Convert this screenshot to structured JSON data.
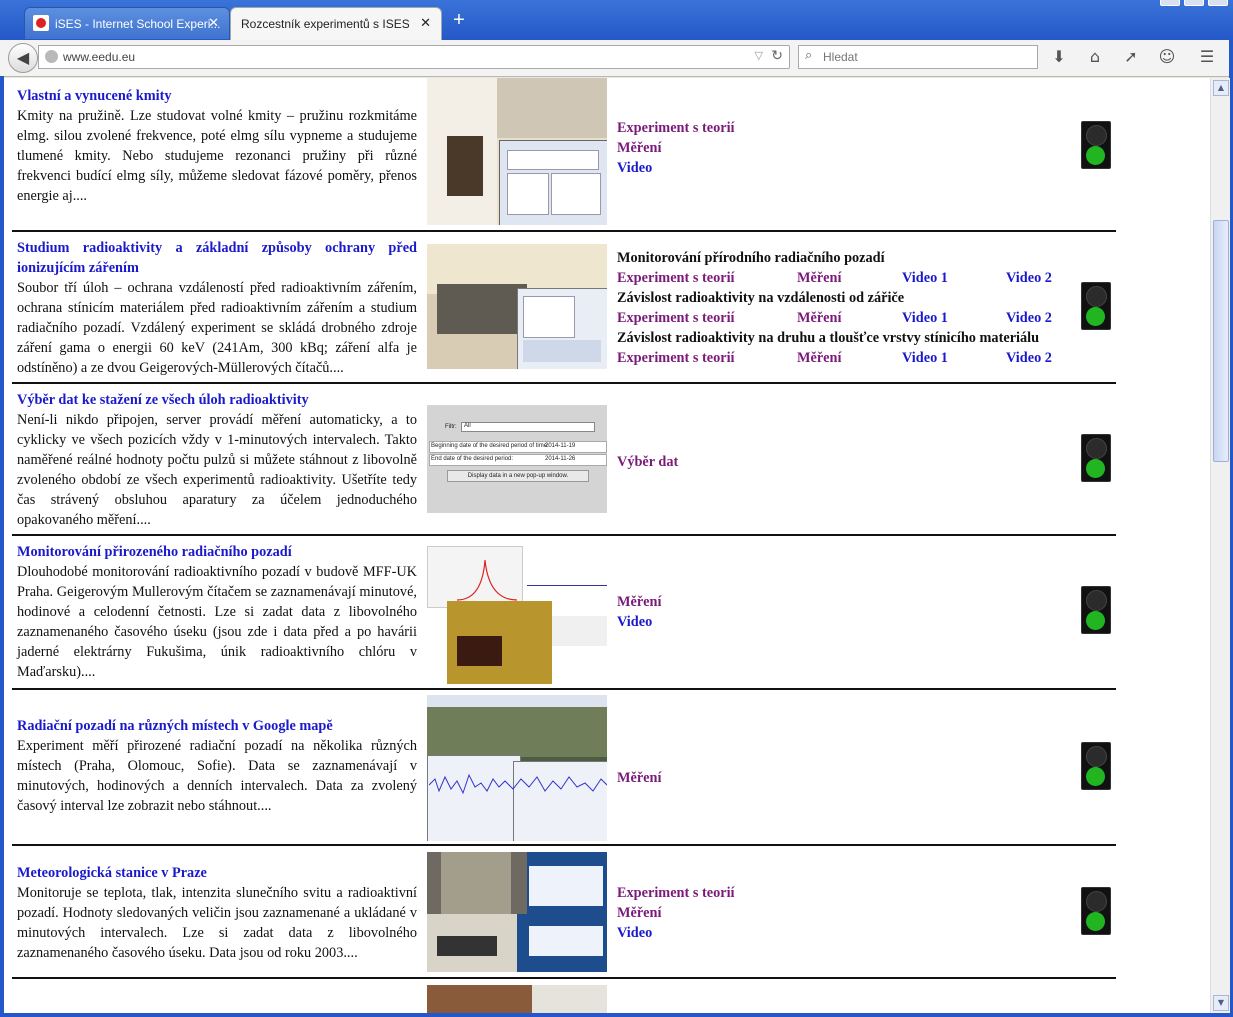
{
  "browser": {
    "tabs": [
      {
        "label": "iSES - Internet School Experi...",
        "close": "✕",
        "active": false
      },
      {
        "label": "Rozcestník experimentů s ISES a i...",
        "close": "✕",
        "active": true
      }
    ],
    "new_tab": "+",
    "url": "www.eedu.eu",
    "search_placeholder": "Hledat"
  },
  "rows": [
    {
      "title": "Vlastní a vynucené kmity",
      "text": "Kmity na pružině. Lze studovat volné kmity – pružinu rozkmitáme elmg. silou zvolené frekvence, poté elmg sílu vypneme a studujeme tlumené kmity. Nebo studujeme rezonanci pružiny při různé frekvenci budící elmg síly, můžeme sledovat fázové poměry, přenos energie aj....",
      "links": [
        "Experiment s teorií",
        "Měření",
        "Video"
      ]
    },
    {
      "title": "Studium radioaktivity a základní způsoby ochrany před ionizujícím zářením",
      "text": "Soubor tří úloh – ochrana vzdáleností před radioaktivním zářením, ochrana stínicím materiálem před radioaktivním zářením a studium radiačního pozadí. Vzdálený experiment se skládá drobného zdroje záření gama o energii 60 keV (241Am, 300 kBq; záření alfa je odstíněno) a ze dvou Geigerových-Müllerových čítačů....",
      "groups": [
        {
          "title": "Monitorování přírodního radiačního pozadí",
          "links": [
            "Experiment s teorií",
            "Měření",
            "Video 1",
            "Video 2"
          ]
        },
        {
          "title": "Závislost radioaktivity na vzdálenosti od zářiče",
          "links": [
            "Experiment s teorií",
            "Měření",
            "Video 1",
            "Video 2"
          ]
        },
        {
          "title": "Závislost radioaktivity na druhu a tloušťce vrstvy stínicího materiálu",
          "links": [
            "Experiment s teorií",
            "Měření",
            "Video 1",
            "Video 2"
          ]
        }
      ]
    },
    {
      "title": "Výběr dat ke stažení ze všech úloh radioaktivity",
      "text": "Není-li nikdo připojen, server provádí měření automaticky, a to cyklicky ve všech pozicích vždy v 1-minutových intervalech. Takto naměřené reálné hodnoty počtu pulzů si můžete stáhnout z libovolně zvoleného období ze všech experimentů radioaktivity. Ušetříte tedy čas strávený obsluhou aparatury za účelem jednoduchého opakovaného měření....",
      "links": [
        "Výběr dat"
      ],
      "form": {
        "filter_label": "Filtr:",
        "filter_value": "All",
        "begin_label": "Beginning date of the desired period of time:",
        "begin_value": "2014-11-19",
        "end_label": "End date of the desired period:",
        "end_value": "2014-11-26",
        "button": "Display data in a new pop-up window."
      }
    },
    {
      "title": "Monitorování přirozeného radiačního pozadí",
      "text": "Dlouhodobé monitorování radioaktivního pozadí v budově MFF-UK Praha. Geigerovým Mullerovým čítačem se zaznamenávají minutové, hodinové a celodenní četnosti. Lze si zadat data z libovolného zaznamenaného časového úseku (jsou zde i data před a po havárii jaderné elektrárny Fukušima, únik radioaktivního chlóru v Maďarsku)....",
      "links": [
        "Měření",
        "Video"
      ]
    },
    {
      "title": "Radiační pozadí na různých místech v Google mapě",
      "text": "Experiment měří přirozené radiační pozadí na několika různých místech (Praha, Olomouc, Sofie). Data se zaznamenávají v minutových, hodinových a denních intervalech. Data za zvolený časový interval lze zobrazit nebo stáhnout....",
      "links": [
        "Měření"
      ]
    },
    {
      "title": "Meteorologická stanice v Praze",
      "text": "Monitoruje se teplota, tlak, intenzita slunečního svitu a radioaktivní pozadí. Hodnoty sledovaných veličin jsou zaznamenané a ukládané v minutových intervalech. Lze si zadat data z libovolného zaznamenaného časového úseku. Data jsou od roku 2003....",
      "links": [
        "Experiment s teorií",
        "Měření",
        "Video"
      ]
    }
  ]
}
